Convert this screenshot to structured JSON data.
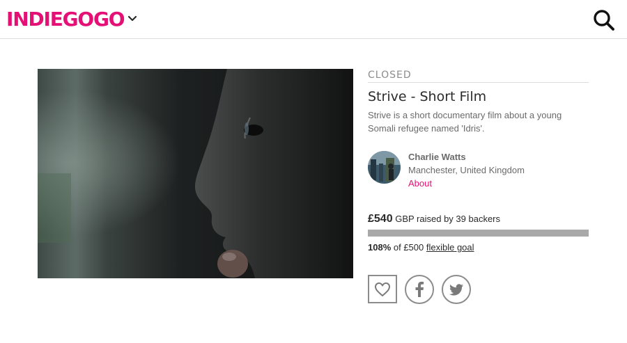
{
  "header": {
    "logo_text": "INDIEGOGO",
    "logo_color": "#e51075",
    "menu_icon": "chevron-down-icon",
    "search_icon": "search-icon"
  },
  "campaign": {
    "status": "CLOSED",
    "title": "Strive - Short Film",
    "description": "Strive is a short documentary film about a young Somali refugee named 'Idris'.",
    "owner": {
      "name": "Charlie Watts",
      "location": "Manchester, United Kingdom",
      "about_label": "About"
    },
    "funding": {
      "amount": "£540",
      "raised_text": "GBP raised by 39 backers",
      "percent_text": "108%",
      "goal_text": "of £500",
      "goal_type": "flexible goal",
      "progress": 1.0
    },
    "actions": {
      "follow_icon": "heart-icon",
      "facebook_icon": "facebook-icon",
      "twitter_icon": "twitter-icon"
    }
  }
}
